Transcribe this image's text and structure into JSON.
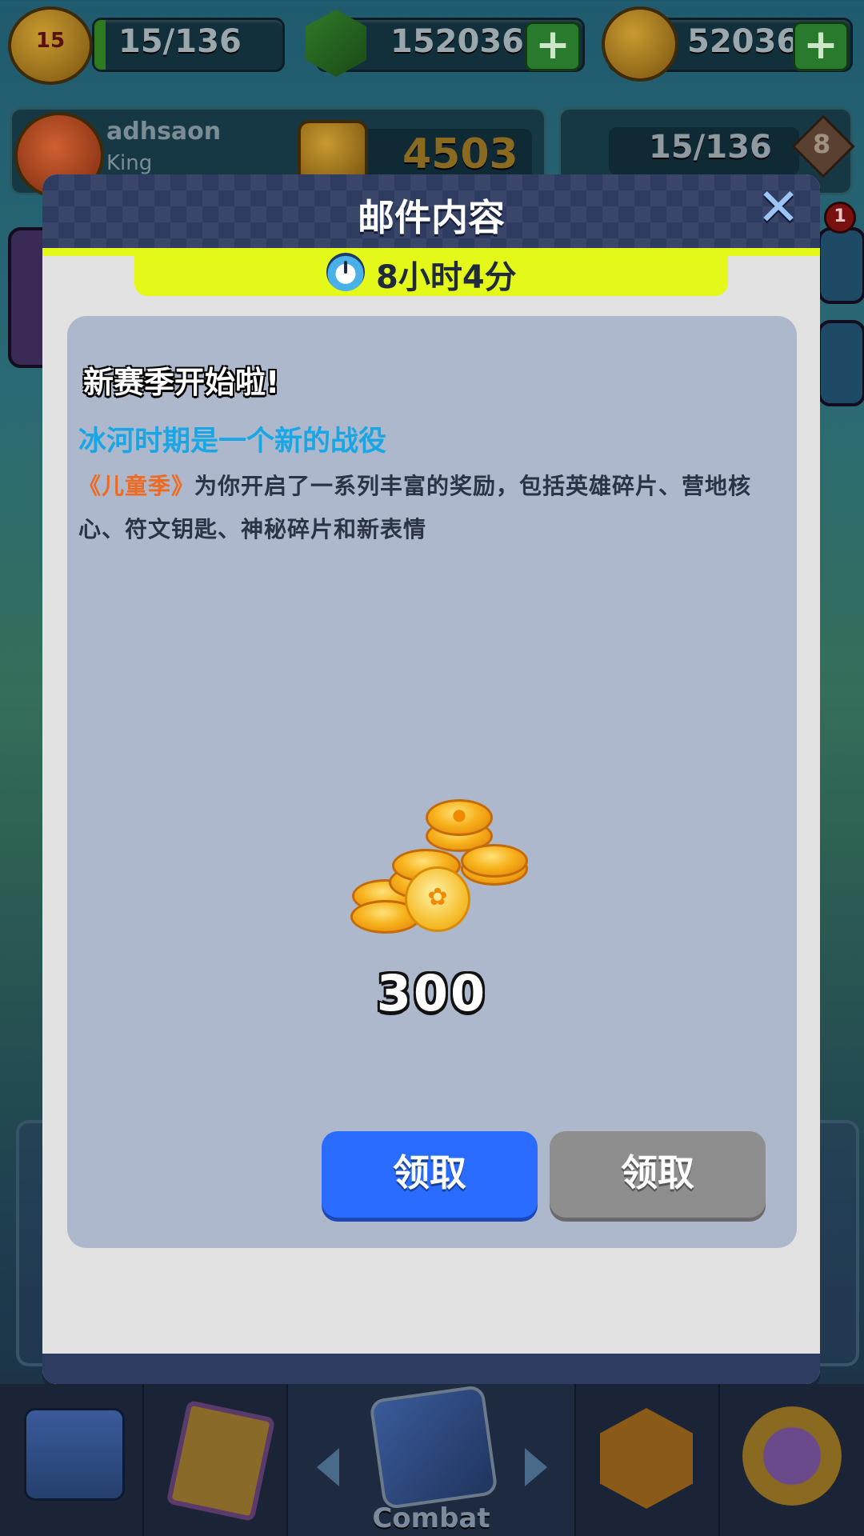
{
  "top_bar": {
    "level": "15",
    "xp": "15/136",
    "gems": "152036",
    "paw_coins": "52036"
  },
  "player": {
    "name": "adhsaon",
    "title": "King",
    "trophies": "4503",
    "progress": "15/136",
    "rank": "8"
  },
  "side": {
    "notification_count": "1"
  },
  "mail": {
    "title": "邮件内容",
    "close_label": "✕",
    "timer": "8小时4分",
    "heading": "新赛季开始啦!",
    "subtitle": "冰河时期是一个新的战役",
    "body_highlight": "《儿童季》",
    "body_text": "为你开启了一系列丰富的奖励，包括英雄碎片、营地核心、符文钥匙、神秘碎片和新表情",
    "reward_amount": "300",
    "claim_button": "领取",
    "claim_button_secondary": "领取"
  },
  "bottom_nav": {
    "combat_label": "Combat"
  },
  "colors": {
    "accent_blue": "#2a6cff",
    "timer_yellow": "#e4f81a",
    "subtitle_blue": "#18a6e4",
    "highlight_orange": "#ee6a20",
    "header_navy": "#2e3c62"
  }
}
